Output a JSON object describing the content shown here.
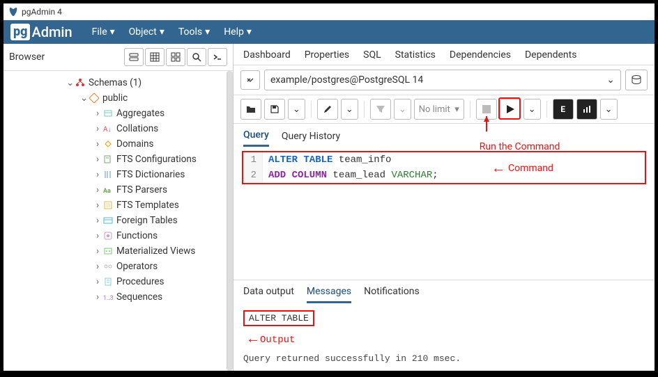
{
  "window": {
    "title": "pgAdmin 4"
  },
  "logo": {
    "prefix": "pg",
    "suffix": "Admin"
  },
  "menu": {
    "file": "File",
    "object": "Object",
    "tools": "Tools",
    "help": "Help"
  },
  "sidebar": {
    "title": "Browser",
    "tree": {
      "schemas": "Schemas (1)",
      "public": "public",
      "items": [
        "Aggregates",
        "Collations",
        "Domains",
        "FTS Configurations",
        "FTS Dictionaries",
        "FTS Parsers",
        "FTS Templates",
        "Foreign Tables",
        "Functions",
        "Materialized Views",
        "Operators",
        "Procedures",
        "Sequences"
      ]
    }
  },
  "tabs": {
    "dashboard": "Dashboard",
    "properties": "Properties",
    "sql": "SQL",
    "statistics": "Statistics",
    "dependencies": "Dependencies",
    "dependents": "Dependents"
  },
  "connection": {
    "label": "example/postgres@PostgreSQL 14"
  },
  "toolbar": {
    "nolimit": "No limit",
    "E": "E"
  },
  "editor": {
    "tabs": {
      "query": "Query",
      "history": "Query History"
    },
    "lines": {
      "l1_num": "1",
      "l2_num": "2",
      "l1_kw": "ALTER TABLE",
      "l1_rest": " team_info",
      "l2_kw": "ADD COLUMN",
      "l2_rest": " team_lead ",
      "l2_type": "VARCHAR",
      "l2_semi": ";"
    }
  },
  "output": {
    "tabs": {
      "data": "Data output",
      "messages": "Messages",
      "notifications": "Notifications"
    },
    "result": "ALTER TABLE",
    "status": "Query returned successfully in 210 msec."
  },
  "annotations": {
    "run": "Run the Command",
    "command": "Command",
    "output": "Output"
  }
}
